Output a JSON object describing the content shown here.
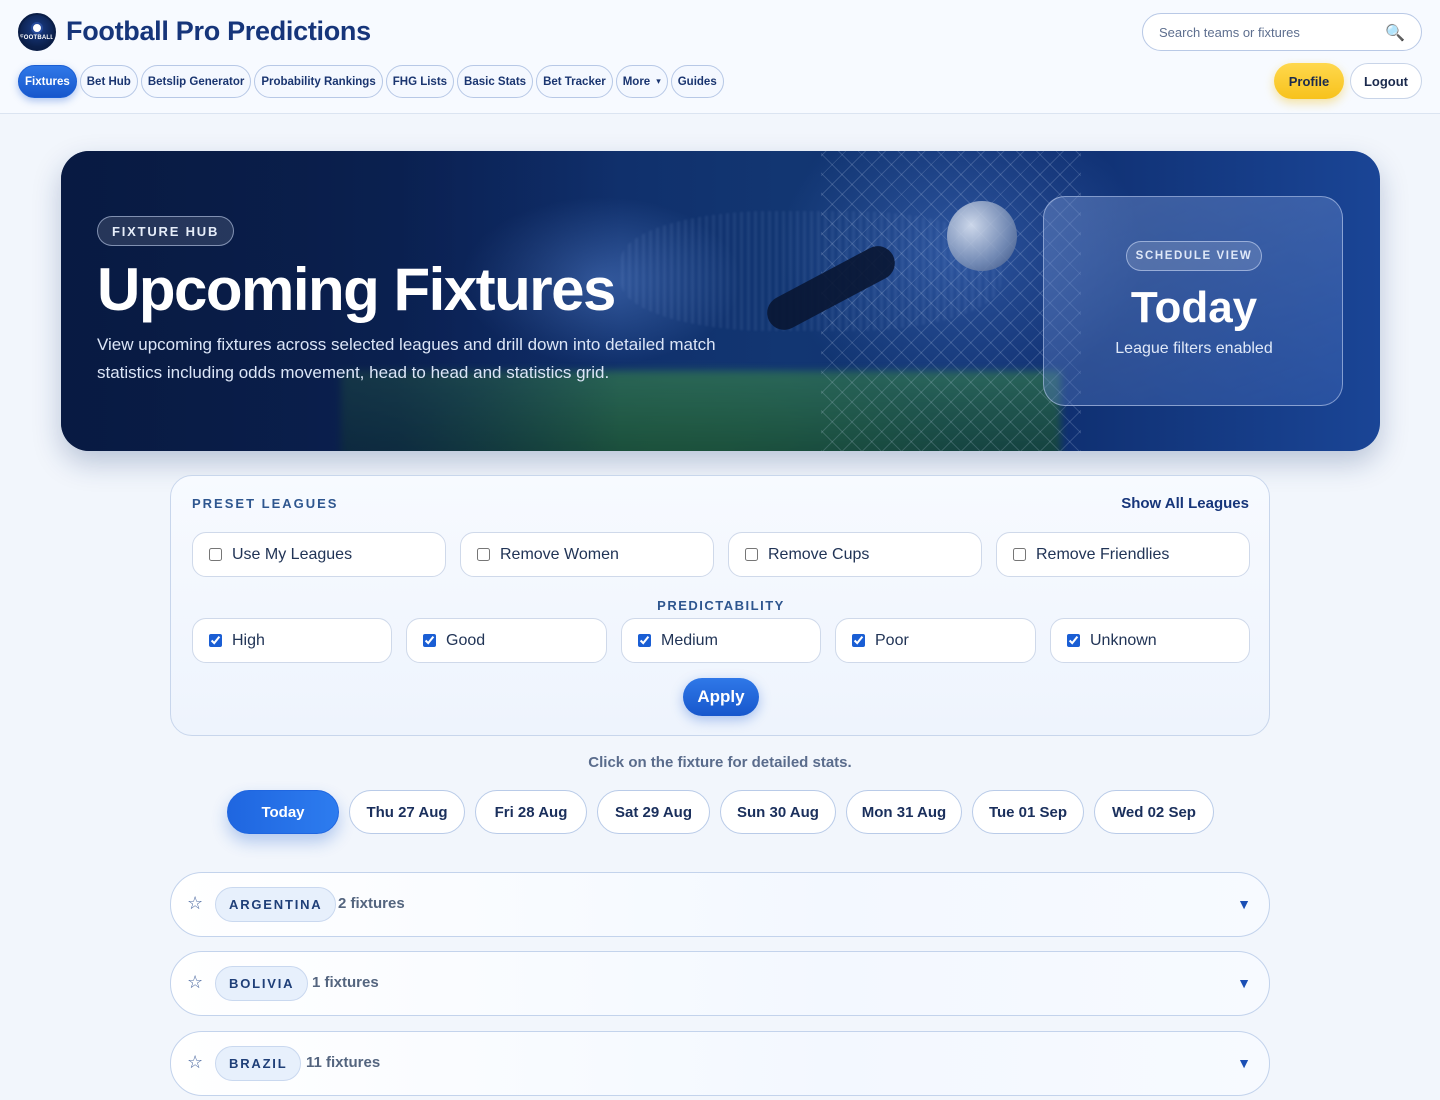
{
  "brand": {
    "logo_text": "FOOTBALL",
    "name": "Football Pro Predictions"
  },
  "search": {
    "placeholder": "Search teams or fixtures",
    "icon": "search-icon"
  },
  "nav": {
    "items": [
      {
        "label": "Fixtures",
        "active": true
      },
      {
        "label": "Bet Hub"
      },
      {
        "label": "Betslip Generator"
      },
      {
        "label": "Probability Rankings"
      },
      {
        "label": "FHG Lists"
      },
      {
        "label": "Basic Stats"
      },
      {
        "label": "Bet Tracker"
      },
      {
        "label": "More",
        "caret": "▾"
      },
      {
        "label": "Guides"
      }
    ],
    "profile_label": "Profile",
    "logout_label": "Logout"
  },
  "hero": {
    "tag": "FIXTURE HUB",
    "title": "Upcoming Fixtures",
    "description": "View upcoming fixtures across selected leagues and drill down into detailed match statistics including odds movement, head to head and statistics grid.",
    "schedule": {
      "tag": "SCHEDULE VIEW",
      "title": "Today",
      "subtitle": "League filters enabled"
    }
  },
  "filters": {
    "preset_label": "PRESET LEAGUES",
    "show_all_label": "Show All Leagues",
    "presets": [
      {
        "label": "Use My Leagues",
        "checked": false
      },
      {
        "label": "Remove Women",
        "checked": false
      },
      {
        "label": "Remove Cups",
        "checked": false
      },
      {
        "label": "Remove Friendlies",
        "checked": false
      }
    ],
    "predictability_label": "PREDICTABILITY",
    "predictability": [
      {
        "label": "High",
        "checked": true
      },
      {
        "label": "Good",
        "checked": true
      },
      {
        "label": "Medium",
        "checked": true
      },
      {
        "label": "Poor",
        "checked": true
      },
      {
        "label": "Unknown",
        "checked": true
      }
    ],
    "apply_label": "Apply"
  },
  "hint": "Click on the fixture for detailed stats.",
  "dates": [
    {
      "label": "Today",
      "active": true
    },
    {
      "label": "Thu 27 Aug"
    },
    {
      "label": "Fri 28 Aug"
    },
    {
      "label": "Sat 29 Aug"
    },
    {
      "label": "Sun 30 Aug"
    },
    {
      "label": "Mon 31 Aug"
    },
    {
      "label": "Tue 01 Sep"
    },
    {
      "label": "Wed 02 Sep"
    }
  ],
  "countries": [
    {
      "name": "ARGENTINA",
      "count": "2 fixtures"
    },
    {
      "name": "BOLIVIA",
      "count": "1 fixtures"
    },
    {
      "name": "BRAZIL",
      "count": "11 fixtures"
    }
  ],
  "glyphs": {
    "star": "☆",
    "chevron": "▼",
    "search": "🔍"
  },
  "colors": {
    "accent": "#1f66e0",
    "brand_text": "#16357a",
    "profile_yellow": "#f7c21c"
  }
}
